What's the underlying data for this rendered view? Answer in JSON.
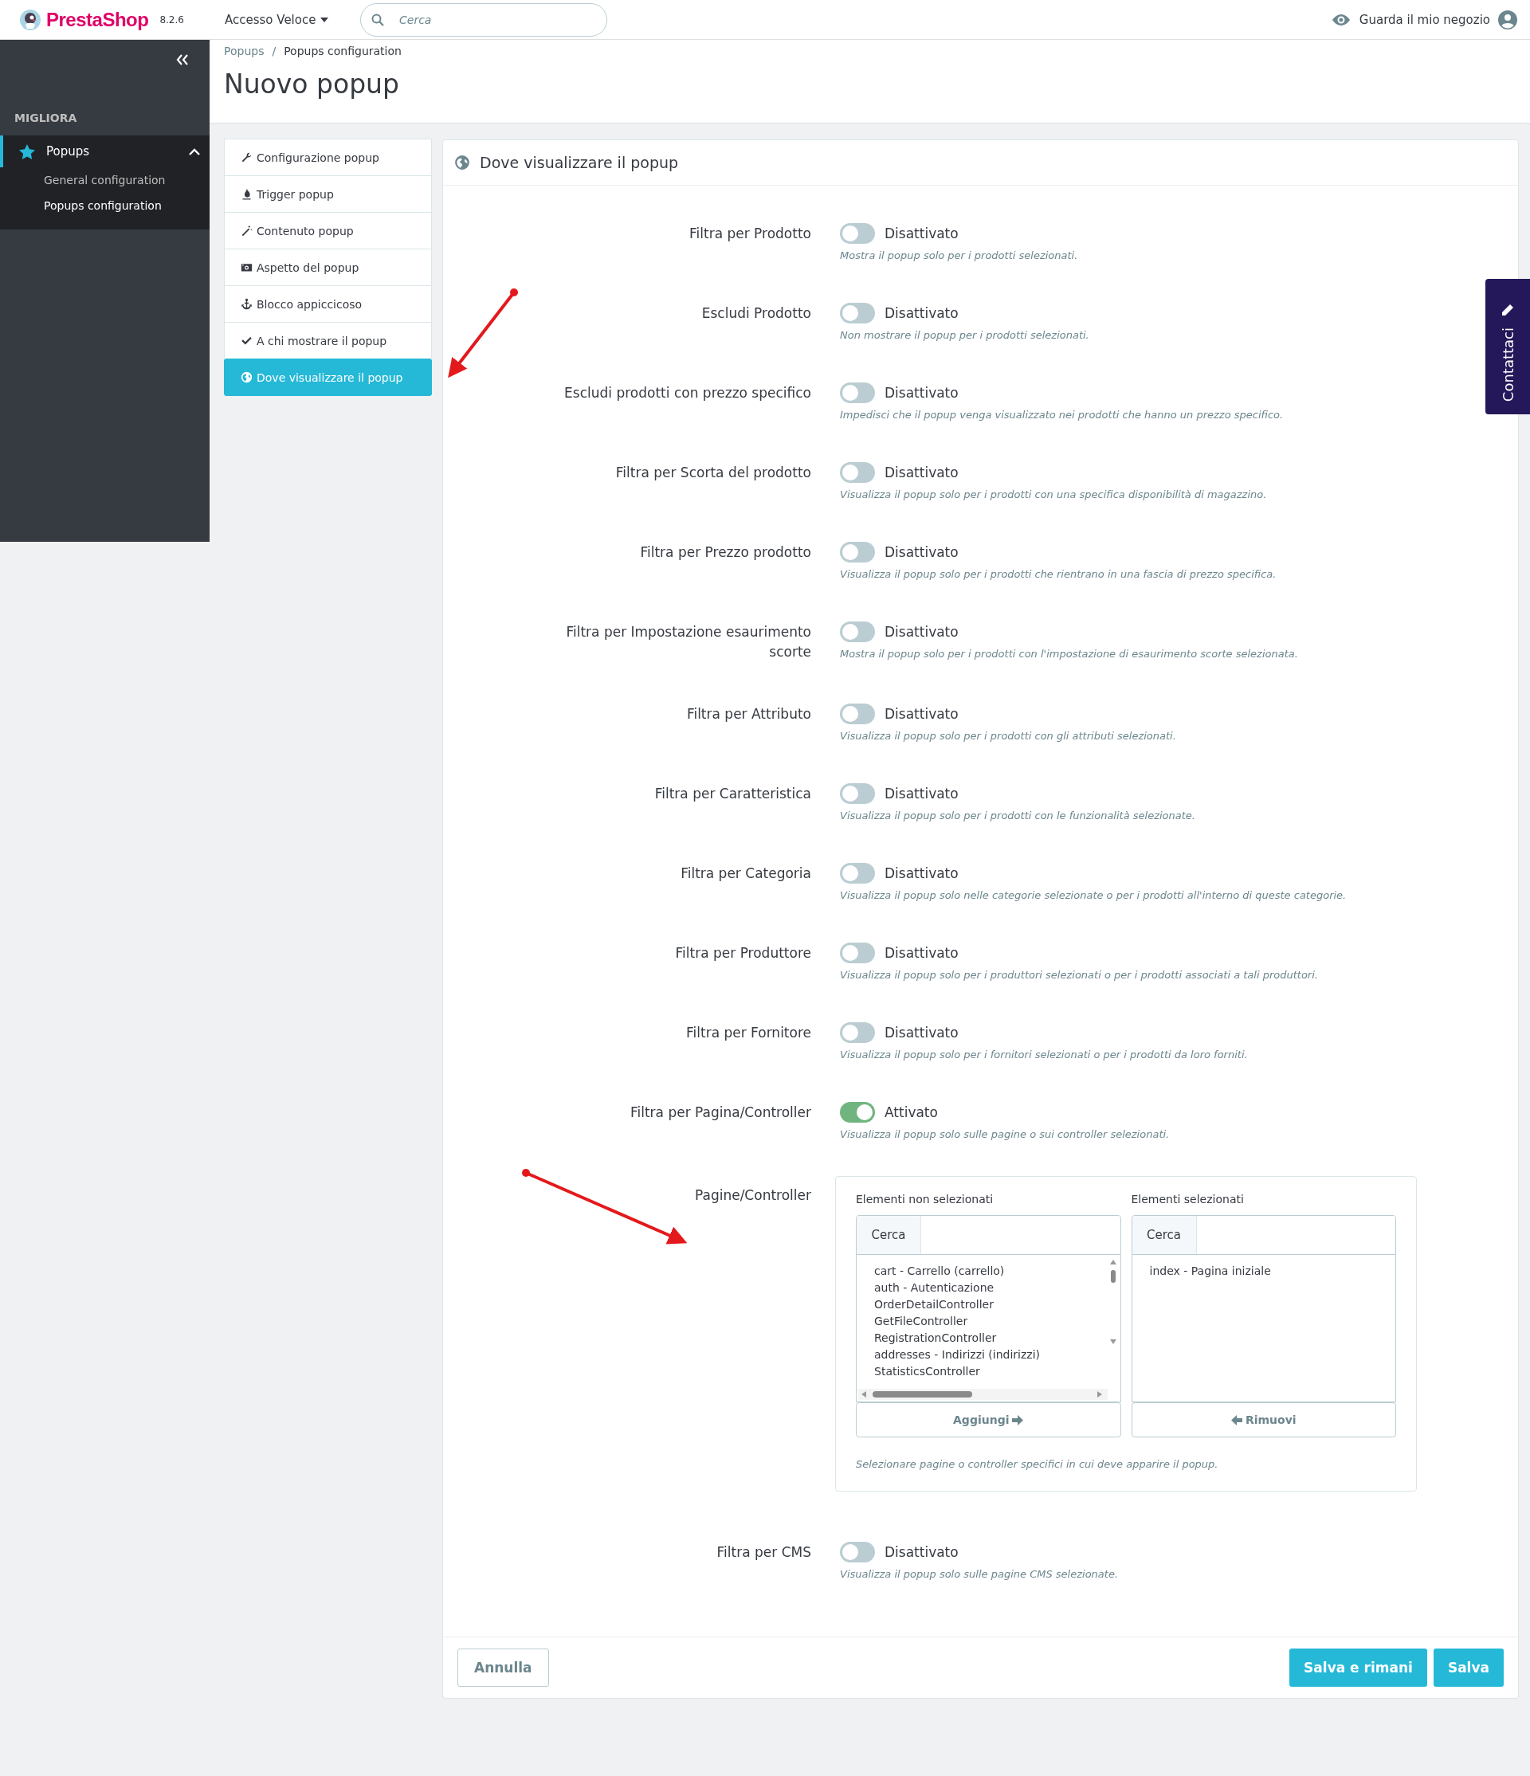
{
  "header": {
    "brand": "PrestaShop",
    "version": "8.2.6",
    "quick_access": "Accesso Veloce",
    "search": {
      "placeholder": "Cerca"
    },
    "view_store": "Guarda il mio negozio"
  },
  "sidebar": {
    "section": "MIGLIORA",
    "items": [
      {
        "label": "Popups",
        "expanded": true,
        "children": [
          {
            "label": "General configuration",
            "selected": false
          },
          {
            "label": "Popups configuration",
            "selected": true
          }
        ]
      }
    ]
  },
  "breadcrumb": [
    "Popups",
    "Popups configuration"
  ],
  "breadcrumb_separator": "/",
  "title": "Nuovo popup",
  "tabs": [
    {
      "label": "Configurazione popup",
      "selected": false
    },
    {
      "label": "Trigger popup",
      "selected": false
    },
    {
      "label": "Contenuto popup",
      "selected": false
    },
    {
      "label": "Aspetto del popup",
      "selected": false
    },
    {
      "label": "Blocco appiccicoso",
      "selected": false
    },
    {
      "label": "A chi mostrare il popup",
      "selected": false
    },
    {
      "label": "Dove visualizzare il popup",
      "selected": true
    }
  ],
  "panel": {
    "title": "Dove visualizzare il popup",
    "fields": [
      {
        "kind": "toggle",
        "label": "Filtra per Prodotto",
        "on": false,
        "state": "Disattivato",
        "help": "Mostra il popup solo per i prodotti selezionati."
      },
      {
        "kind": "toggle",
        "label": "Escludi Prodotto",
        "on": false,
        "state": "Disattivato",
        "help": "Non mostrare il popup per i prodotti selezionati."
      },
      {
        "kind": "toggle",
        "label": "Escludi prodotti con prezzo specifico",
        "on": false,
        "state": "Disattivato",
        "help": "Impedisci che il popup venga visualizzato nei prodotti che hanno un prezzo specifico."
      },
      {
        "kind": "toggle",
        "label": "Filtra per Scorta del prodotto",
        "on": false,
        "state": "Disattivato",
        "help": "Visualizza il popup solo per i prodotti con una specifica disponibilità di magazzino."
      },
      {
        "kind": "toggle",
        "label": "Filtra per Prezzo prodotto",
        "on": false,
        "state": "Disattivato",
        "help": "Visualizza il popup solo per i prodotti che rientrano in una fascia di prezzo specifica."
      },
      {
        "kind": "toggle",
        "label": "Filtra per Impostazione esaurimento scorte",
        "on": false,
        "state": "Disattivato",
        "help": "Mostra il popup solo per i prodotti con l'impostazione di esaurimento scorte selezionata."
      },
      {
        "kind": "toggle",
        "label": "Filtra per Attributo",
        "on": false,
        "state": "Disattivato",
        "help": "Visualizza il popup solo per i prodotti con gli attributi selezionati."
      },
      {
        "kind": "toggle",
        "label": "Filtra per Caratteristica",
        "on": false,
        "state": "Disattivato",
        "help": "Visualizza il popup solo per i prodotti con le funzionalità selezionate."
      },
      {
        "kind": "toggle",
        "label": "Filtra per Categoria",
        "on": false,
        "state": "Disattivato",
        "help": "Visualizza il popup solo nelle categorie selezionate o per i prodotti all'interno di queste categorie."
      },
      {
        "kind": "toggle",
        "label": "Filtra per Produttore",
        "on": false,
        "state": "Disattivato",
        "help": "Visualizza il popup solo per i produttori selezionati o per i prodotti associati a tali produttori."
      },
      {
        "kind": "toggle",
        "label": "Filtra per Fornitore",
        "on": false,
        "state": "Disattivato",
        "help": "Visualizza il popup solo per i fornitori selezionati o per i prodotti da loro forniti."
      },
      {
        "kind": "toggle",
        "label": "Filtra per Pagina/Controller",
        "on": true,
        "state": "Attivato",
        "help": "Visualizza il popup solo sulle pagine o sui controller selezionati."
      },
      {
        "kind": "duallist",
        "label": "Pagine/Controller",
        "left": {
          "heading": "Elementi non selezionati",
          "search_label": "Cerca",
          "items": [
            "cart - Carrello (carrello)",
            "auth - Autenticazione",
            "OrderDetailController",
            "GetFileController",
            "RegistrationController",
            "addresses - Indirizzi (indirizzi)",
            "StatisticsController"
          ],
          "button": "Aggiungi"
        },
        "right": {
          "heading": "Elementi selezionati",
          "search_label": "Cerca",
          "items": [
            "index - Pagina iniziale"
          ],
          "button": "Rimuovi"
        },
        "help": "Selezionare pagine o controller specifici in cui deve apparire il popup."
      },
      {
        "kind": "toggle",
        "label": "Filtra per CMS",
        "on": false,
        "state": "Disattivato",
        "help": "Visualizza il popup solo sulle pagine CMS selezionate."
      }
    ]
  },
  "footer": {
    "cancel": "Annulla",
    "save_stay": "Salva e rimani",
    "save": "Salva"
  },
  "contact_tab": "Contattaci"
}
